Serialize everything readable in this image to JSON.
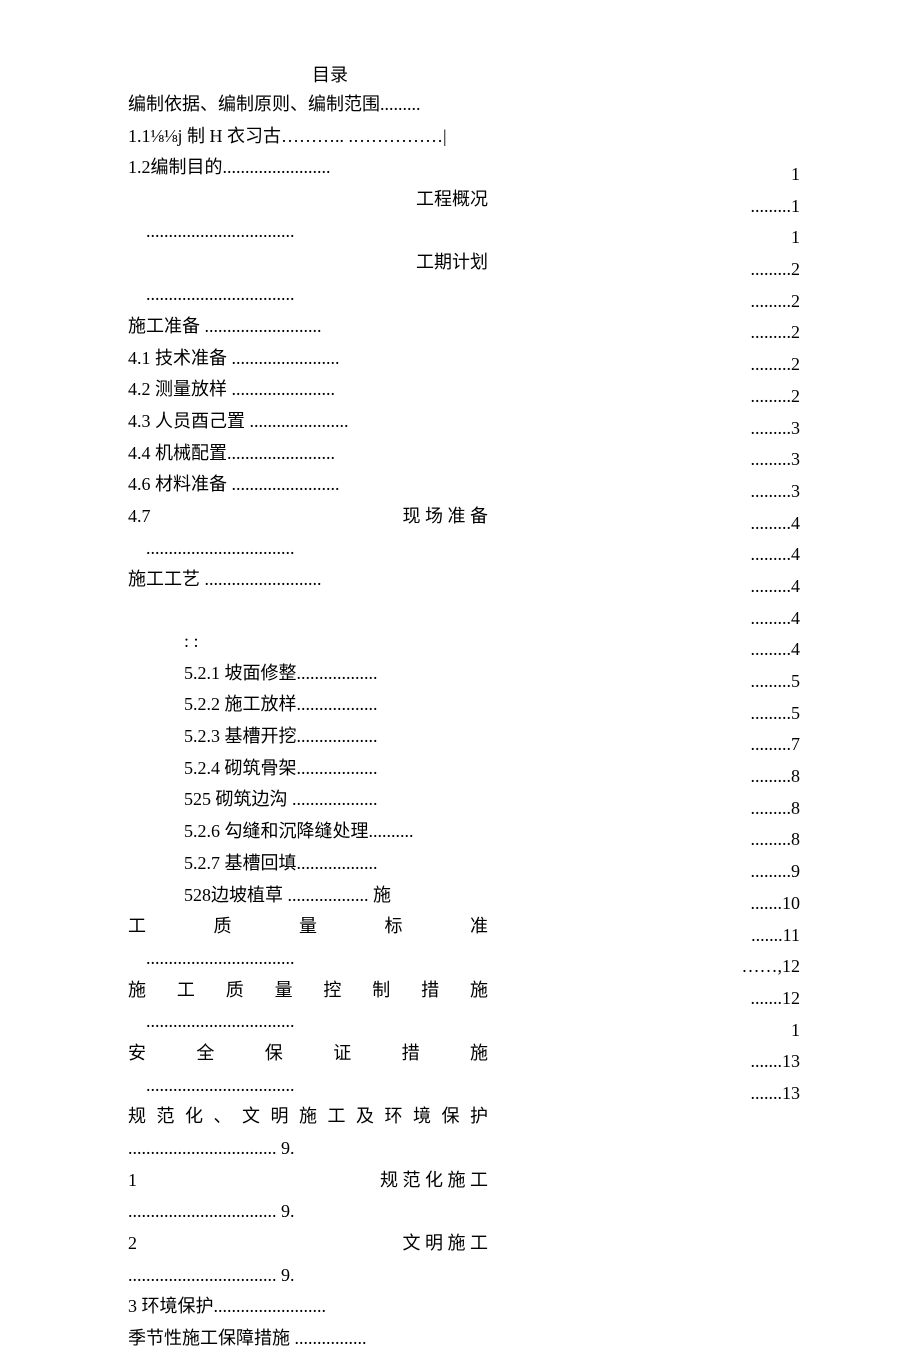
{
  "title": "目录",
  "left": {
    "l01": "编制依据、编制原则、编制范围.........",
    "l02": "1.1⅛⅛j 制 H 衣习古……….. .……………| ",
    "l03": "1.2编制目的........................",
    "l04": "工程概况",
    "l05": ".................................",
    "l06": "工期计划",
    "l07": ".................................",
    "l08": " 施工准备 ..........................",
    "l09": "4.1 技术准备 ........................",
    "l10": "4.2 测量放样 .......................",
    "l11": "4.3 人员酉己置 ......................",
    "l12": "4.4 机械配置........................",
    "l13": "4.6 材料准备 ........................",
    "l14_a": "4.7",
    "l14_b": "现  场  准  备",
    "l15": ".................................",
    "l16": "施工工艺 ..........................",
    "l17": "",
    "l18": ": :",
    "l19": "5.2.1 坡面修整..................",
    "l20": "5.2.2 施工放样..................",
    "l21": "5.2.3 基槽开挖..................",
    "l22": "5.2.4 砌筑骨架..................",
    "l23": "525 砌筑边沟 ...................",
    "l24": "5.2.6 勾缝和沉降缝处理..........",
    "l25": "5.2.7 基槽回填..................",
    "l26": "528边坡植草 .................. 施",
    "l27": "工      质      量      标      准",
    "l28": ".................................",
    "l29": "施  工  质  量  控  制  措  施",
    "l30": ".................................",
    "l31": "安    全    保    证    措    施",
    "l32": ".................................",
    "l33": "规 范 化 、 文 明 施 工 及 环 境 保 护",
    "l34": "................................. 9.",
    "l35_a": "1",
    "l35_b": "规  范  化  施  工",
    "l36": "................................. 9.",
    "l37_a": "2",
    "l37_b": "文  明  施  工",
    "l38": "................................. 9.",
    "l39": "3 环境保护.........................",
    "l40": "   季节性施工保障措施 ................"
  },
  "right": {
    "p01": "1",
    "p02": ".........1",
    "p03": "1",
    "p04": ".........2",
    "p05": ".........2",
    "p06": ".........2",
    "p07": ".........2",
    "p08": ".........2",
    "p09": ".........3",
    "p10": ".........3",
    "p11": ".........3",
    "p12": ".........4",
    "p13": ".........4",
    "p14": ".........4",
    "p15": ".........4",
    "p16": ".........4",
    "p17": ".........5",
    "p18": ".........5",
    "p19": ".........7",
    "p20": ".........8",
    "p21": ".........8",
    "p22": ".........8",
    "p23": ".........9",
    "p24": ".......10",
    "p25": ".......11",
    "p26": "……,12",
    "p27": ".......12",
    "p28": "1",
    "p29": ".......13",
    "p30": ".......13"
  }
}
